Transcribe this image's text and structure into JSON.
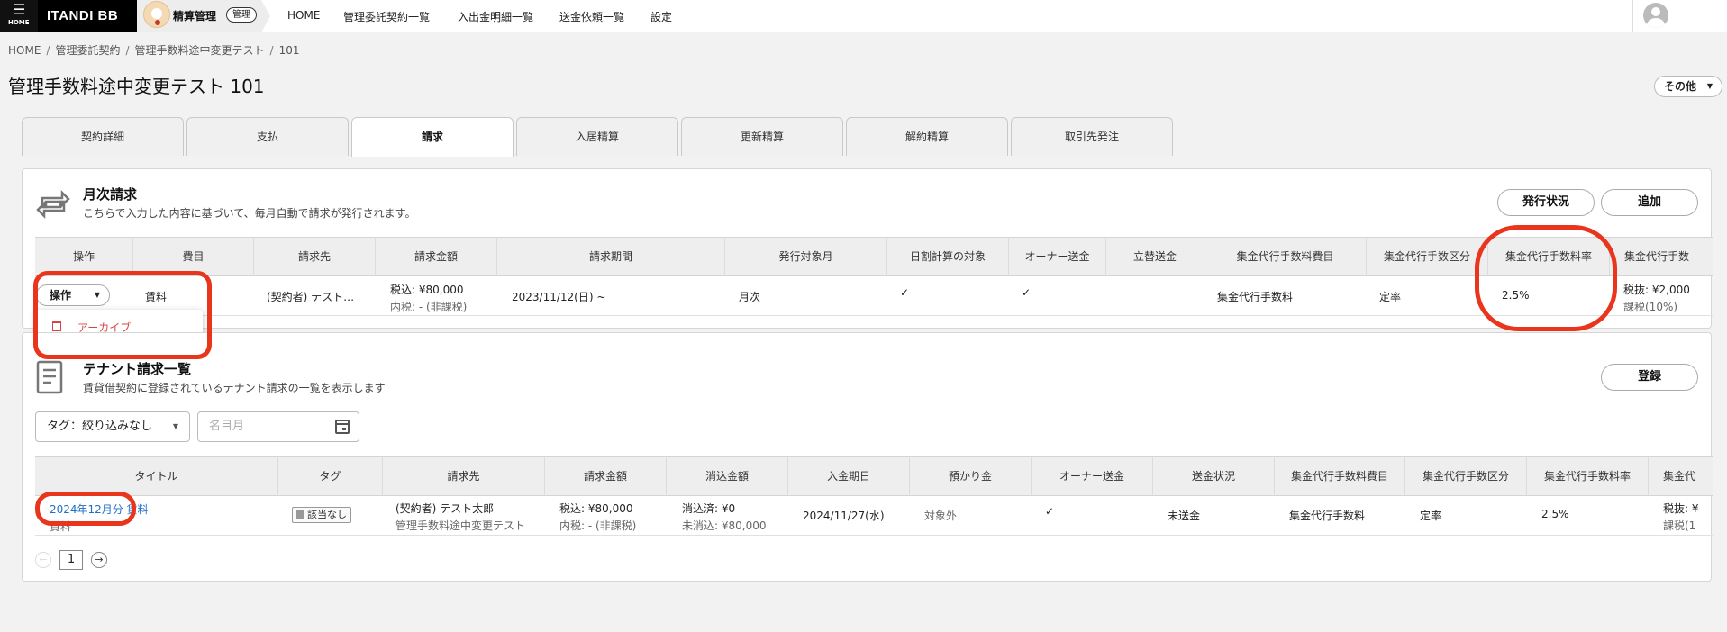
{
  "topbar": {
    "menu_glyph": "☰",
    "menu_label": "HOME",
    "logo": "ITANDI BB",
    "app_name": "精算管理",
    "app_badge": "管理",
    "nav": [
      "HOME",
      "管理委託契約一覧",
      "入出金明細一覧",
      "送金依頼一覧",
      "設定"
    ]
  },
  "breadcrumb": [
    "HOME",
    "管理委託契約",
    "管理手数料途中変更テスト",
    "101"
  ],
  "page_title": "管理手数料途中変更テスト 101",
  "other_button": "その他",
  "tabs": [
    "契約詳細",
    "支払",
    "請求",
    "入居精算",
    "更新精算",
    "解約精算",
    "取引先発注"
  ],
  "active_tab": "請求",
  "monthly": {
    "title": "月次請求",
    "description": "こちらで入力した内容に基づいて、毎月自動で請求が発行されます。",
    "status_button": "発行状況",
    "add_button": "追加",
    "columns": [
      "操作",
      "費目",
      "請求先",
      "請求金額",
      "請求期間",
      "発行対象月",
      "日割計算の対象",
      "オーナー送金",
      "立替送金",
      "集金代行手数料費目",
      "集金代行手数区分",
      "集金代行手数料率",
      "集金代行手数"
    ],
    "row": {
      "op_button": "操作",
      "item": "賃料",
      "billing_to": "(契約者) テスト…",
      "amount": "税込: ¥80,000",
      "amount_sub": "内税: - (非課税)",
      "period": "2023/11/12(日) ~",
      "target_month": "月次",
      "prorated": "✓",
      "owner_remit": "✓",
      "advance_remit": "",
      "fee_item": "集金代行手数料",
      "fee_type": "定率",
      "fee_rate": "2.5%",
      "fee": "税抜: ¥2,000",
      "fee_sub": "課税(10%)"
    },
    "dropdown_item": "アーカイブ"
  },
  "tenant": {
    "title": "テナント請求一覧",
    "description": "賃貸借契約に登録されているテナント請求の一覧を表示します",
    "register_button": "登録",
    "tag_filter": "タグ：絞り込みなし",
    "month_placeholder": "名目月",
    "columns": [
      "タイトル",
      "タグ",
      "請求先",
      "請求金額",
      "消込金額",
      "入金期日",
      "預かり金",
      "オーナー送金",
      "送金状況",
      "集金代行手数料費目",
      "集金代行手数区分",
      "集金代行手数料率",
      "集金代"
    ],
    "row": {
      "title_link": "2024年12月分 賃料",
      "title_sub": "賃料",
      "tag": "該当なし",
      "billing_to": "(契約者) テスト太郎",
      "billing_to_sub": "管理手数料途中変更テスト",
      "amount": "税込: ¥80,000",
      "amount_sub": "内税: - (非課税)",
      "cleared": "消込済: ¥0",
      "uncleared": "未消込: ¥80,000",
      "due_date": "2024/11/27(水)",
      "deposit": "対象外",
      "owner_remit": "✓",
      "remit_status": "未送金",
      "fee_item": "集金代行手数料",
      "fee_type": "定率",
      "fee_rate": "2.5%",
      "fee": "税抜: ¥",
      "fee_sub": "課税(1"
    },
    "pager": {
      "prev": "←",
      "page": "1",
      "next": "→"
    }
  },
  "colors": {
    "accent_red": "#e8351c",
    "link": "#1f6fc5",
    "danger": "#d64545"
  }
}
